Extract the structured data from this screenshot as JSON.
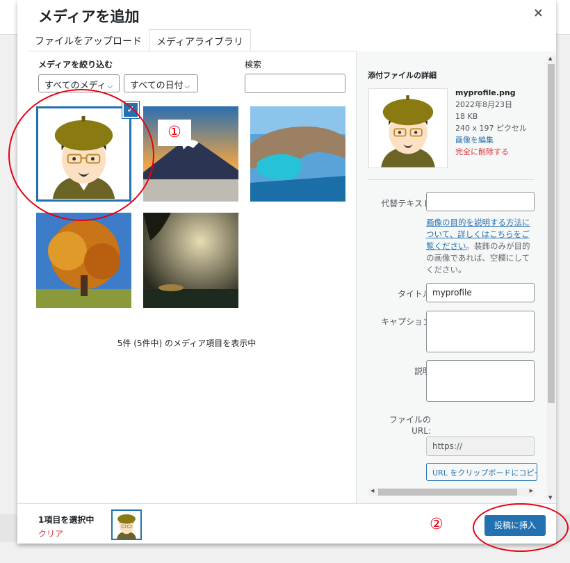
{
  "modal": {
    "title": "メディアを追加",
    "close_glyph": "×"
  },
  "tabs": [
    {
      "label": "ファイルをアップロード"
    },
    {
      "label": "メディアライブラリ"
    }
  ],
  "browser": {
    "filter_label": "メディアを絞り込む",
    "type_select": "すべてのメディ",
    "date_select": "すべての日付",
    "search_label": "検索",
    "count_text": "5件 (5件中) のメディア項目を表示中",
    "check_glyph": "✓"
  },
  "details": {
    "heading": "添付ファイルの詳細",
    "filename": "myprofile.png",
    "date": "2022年8月23日",
    "size": "18 KB",
    "dimensions": "240 x 197 ピクセル",
    "edit_link": "画像を編集",
    "delete_link": "完全に削除する",
    "alt_label": "代替テキスト",
    "alt_help_link": "画像の目的を説明する方法について、詳しくはこちらをご覧ください",
    "alt_help_rest": "。装飾のみが目的の画像であれば、空欄にしてください。",
    "title_label": "タイトル",
    "title_value": "myprofile",
    "caption_label": "キャプション",
    "description_label": "説明",
    "url_label_1": "ファイルの",
    "url_label_2": "URL:",
    "url_value": "https://",
    "copy_button": "URL をクリップボードにコピー"
  },
  "toolbar": {
    "selected_count": "1項目を選択中",
    "clear_link": "クリア",
    "insert_button": "投稿に挿入"
  },
  "annotations": {
    "marker_1": "①",
    "marker_2": "②",
    "color": "#e60012"
  },
  "colors": {
    "accent": "#2271b1",
    "danger": "#d63638"
  }
}
